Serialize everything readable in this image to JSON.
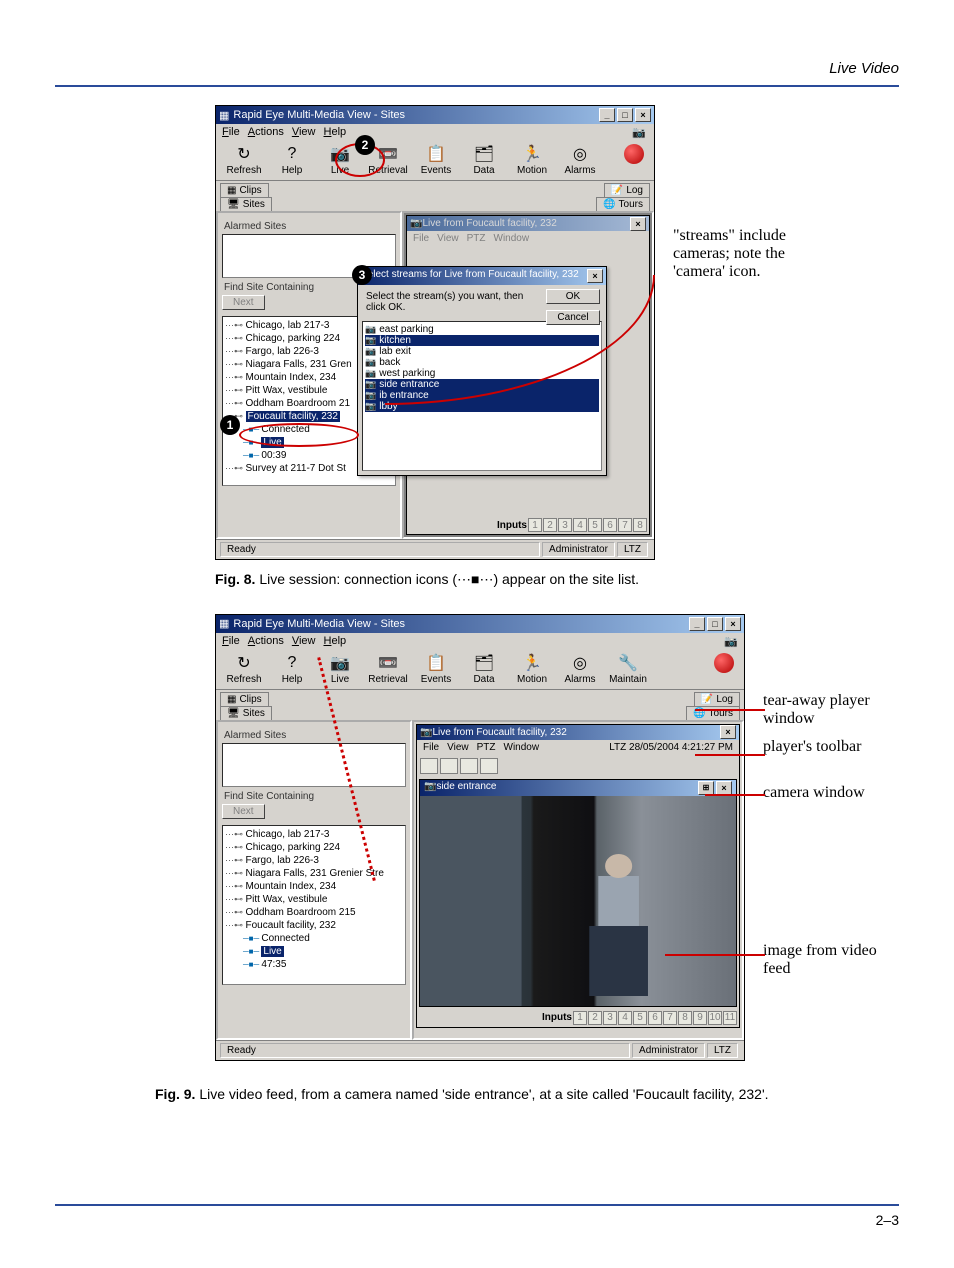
{
  "header": {
    "section_title": "Live Video"
  },
  "fig8": {
    "window_title": "Rapid Eye Multi-Media View - Sites",
    "menu": [
      "File",
      "Actions",
      "View",
      "Help"
    ],
    "toolbar": [
      "Refresh",
      "Help",
      "Live",
      "Retrieval",
      "Events",
      "Data",
      "Motion",
      "Alarms"
    ],
    "tabs_left": [
      "Clips",
      "Sites"
    ],
    "tabs_right": [
      "Log",
      "Tours"
    ],
    "alarmed_sites_label": "Alarmed Sites",
    "find_site_label": "Find Site Containing",
    "next_btn": "Next",
    "tree": [
      "Chicago, lab 217-3",
      "Chicago, parking 224",
      "Fargo, lab 226-3",
      "Niagara Falls, 231 Gren",
      "Mountain Index, 234",
      "Pitt Wax, vestibule",
      "Oddham Boardroom 21",
      "Foucault facility, 232",
      "Survey at 211-7 Dot St"
    ],
    "tree_children": [
      "Connected",
      "Live",
      "00:39"
    ],
    "inner_win_title": "Live from Foucault facility, 232",
    "inner_menu": [
      "File",
      "View",
      "PTZ",
      "Window"
    ],
    "dialog_title": "Select streams for Live from Foucault facility, 232",
    "dialog_instr": "Select the stream(s) you want, then click OK.",
    "dialog_ok": "OK",
    "dialog_cancel": "Cancel",
    "streams": [
      "east parking",
      "kitchen",
      "lab exit",
      "back",
      "west parking",
      "side entrance",
      "ib entrance",
      "lbby"
    ],
    "streams_selected": [
      1,
      5,
      6,
      7
    ],
    "inputs_label": "Inputs",
    "inputs": [
      "1",
      "2",
      "3",
      "4",
      "5",
      "6",
      "7",
      "8"
    ],
    "status_ready": "Ready",
    "status_user": "Administrator",
    "status_tz": "LTZ",
    "side_annotation": "\"streams\" include cameras; note the 'camera' icon.",
    "caption_bold": "Fig. 8.",
    "caption_rest": " Live session: connection icons  (⋯■⋯) appear on the site list."
  },
  "fig9": {
    "window_title": "Rapid Eye Multi-Media View - Sites",
    "menu": [
      "File",
      "Actions",
      "View",
      "Help"
    ],
    "toolbar": [
      "Refresh",
      "Help",
      "Live",
      "Retrieval",
      "Events",
      "Data",
      "Motion",
      "Alarms",
      "Maintain"
    ],
    "tabs_left": [
      "Clips",
      "Sites"
    ],
    "tabs_right": [
      "Log",
      "Tours"
    ],
    "alarmed_sites_label": "Alarmed Sites",
    "find_site_label": "Find Site Containing",
    "next_btn": "Next",
    "tree": [
      "Chicago, lab 217-3",
      "Chicago, parking 224",
      "Fargo, lab 226-3",
      "Niagara Falls, 231 Grenier Stre",
      "Mountain Index, 234",
      "Pitt Wax, vestibule",
      "Oddham Boardroom 215",
      "Foucault facility, 232"
    ],
    "tree_children": [
      "Connected",
      "Live",
      "47:35"
    ],
    "inner_win_title": "Live from Foucault facility, 232",
    "inner_menu": [
      "File",
      "View",
      "PTZ",
      "Window"
    ],
    "timestamp": "LTZ 28/05/2004 4:21:27 PM",
    "camera_title": "side entrance",
    "inputs_label": "Inputs",
    "inputs": [
      "1",
      "2",
      "3",
      "4",
      "5",
      "6",
      "7",
      "8",
      "9",
      "10",
      "11"
    ],
    "status_ready": "Ready",
    "status_user": "Administrator",
    "status_tz": "LTZ",
    "annotations": [
      "tear-away player window",
      "player's toolbar",
      "camera window",
      "image from video feed"
    ],
    "caption_bold": "Fig. 9.",
    "caption_rest": " Live video feed, from a camera named 'side entrance', at a site called 'Foucault facility, 232'."
  },
  "footer": {
    "page": "2–3"
  }
}
